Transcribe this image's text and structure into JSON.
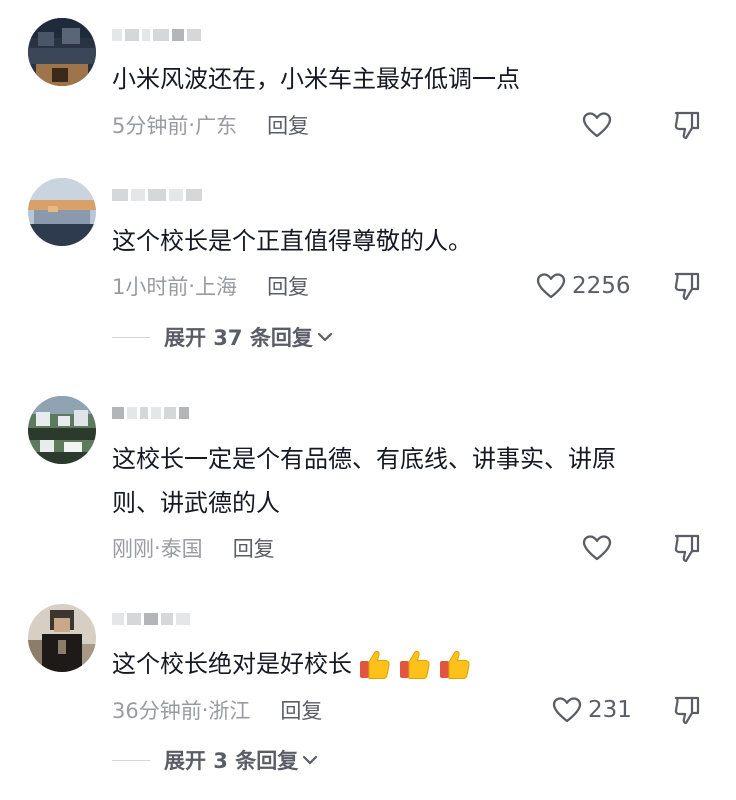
{
  "comments": [
    {
      "text": "小米风波还在，小米车主最好低调一点",
      "time": "5分钟前",
      "location": "广东",
      "reply_label": "回复",
      "like_count": "",
      "avatar_colors": [
        "#1f2a3a",
        "#4a5668",
        "#a0744a",
        "#3a2a1a"
      ]
    },
    {
      "text": "这个校长是个正直值得尊敬的人。",
      "time": "1小时前",
      "location": "上海",
      "reply_label": "回复",
      "like_count": "2256",
      "expand_label": "展开 37 条回复",
      "avatar_colors": [
        "#b8c7d6",
        "#8a99ab",
        "#d9a06a",
        "#2e3b4e"
      ]
    },
    {
      "text_line1": "这校长一定是个有品德、有底线、讲事实、讲原",
      "text_line2": "则、讲武德的人",
      "time": "刚刚",
      "location": "泰国",
      "reply_label": "回复",
      "like_count": "",
      "avatar_colors": [
        "#2b3a2c",
        "#e9ecef",
        "#5e7a5c",
        "#8fa3b3"
      ]
    },
    {
      "text": "这个校长绝对是好校长",
      "emoji_name": "thumbs-up-icon",
      "time": "36分钟前",
      "location": "浙江",
      "reply_label": "回复",
      "like_count": "231",
      "expand_label": "展开 3 条回复",
      "avatar_colors": [
        "#d7cfc3",
        "#3b3630",
        "#8c7d6a",
        "#1d1a17"
      ]
    }
  ],
  "meta_separator": " · ",
  "icons": {
    "like": "heart-outline-icon",
    "dislike": "thumbs-down-outline-icon",
    "expand": "chevron-down-icon"
  },
  "colors": {
    "text": "#161823",
    "meta": "#9a9ba2",
    "action": "#5b5d66"
  }
}
